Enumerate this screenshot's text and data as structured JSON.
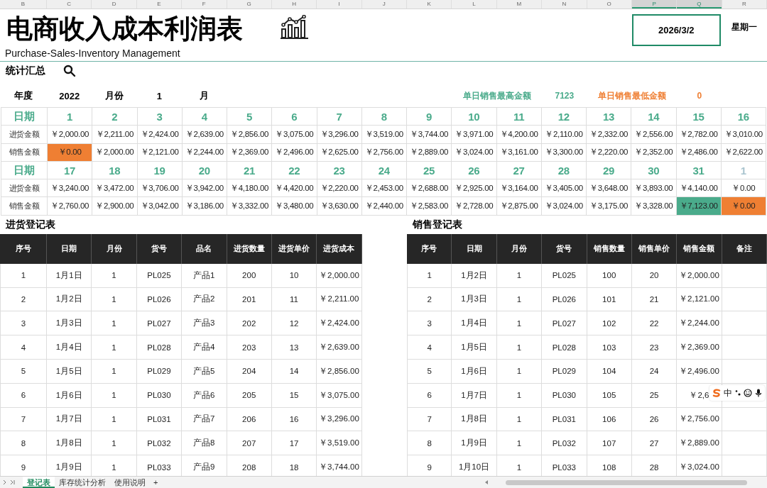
{
  "columns": [
    {
      "label": "B",
      "selected": false
    },
    {
      "label": "C",
      "selected": false
    },
    {
      "label": "D",
      "selected": false
    },
    {
      "label": "E",
      "selected": false
    },
    {
      "label": "F",
      "selected": false
    },
    {
      "label": "G",
      "selected": false
    },
    {
      "label": "H",
      "selected": false
    },
    {
      "label": "I",
      "selected": false
    },
    {
      "label": "J",
      "selected": false
    },
    {
      "label": "K",
      "selected": false
    },
    {
      "label": "L",
      "selected": false
    },
    {
      "label": "M",
      "selected": false
    },
    {
      "label": "N",
      "selected": false
    },
    {
      "label": "O",
      "selected": false
    },
    {
      "label": "P",
      "selected": true
    },
    {
      "label": "Q",
      "selected": true
    },
    {
      "label": "R",
      "selected": false
    }
  ],
  "header": {
    "title": "电商收入成本利润表",
    "subtitle": "Purchase-Sales-Inventory Management",
    "date": "2026/3/2",
    "weekday": "星期一",
    "section": "统计汇总"
  },
  "summary": {
    "year_label": "年度",
    "year": "2022",
    "month_label": "月份",
    "month": "1",
    "month_unit": "月",
    "max_label": "单日销售最高金额",
    "max_value": "7123",
    "min_label": "单日销售最低金额",
    "min_value": "0"
  },
  "calendar": {
    "blocks": [
      {
        "day_label": "日期",
        "purchase_label": "进货金额",
        "sales_label": "销售金额",
        "days": [
          {
            "day": "1",
            "faded": false,
            "purchase": "￥2,000.00",
            "sales": "￥0.00",
            "color": "#ef7f33"
          },
          {
            "day": "2",
            "faded": false,
            "purchase": "￥2,211.00",
            "sales": "￥2,000.00"
          },
          {
            "day": "3",
            "faded": false,
            "purchase": "￥2,424.00",
            "sales": "￥2,121.00"
          },
          {
            "day": "4",
            "faded": false,
            "purchase": "￥2,639.00",
            "sales": "￥2,244.00"
          },
          {
            "day": "5",
            "faded": false,
            "purchase": "￥2,856.00",
            "sales": "￥2,369.00"
          },
          {
            "day": "6",
            "faded": false,
            "purchase": "￥3,075.00",
            "sales": "￥2,496.00"
          },
          {
            "day": "7",
            "faded": false,
            "purchase": "￥3,296.00",
            "sales": "￥2,625.00"
          },
          {
            "day": "8",
            "faded": false,
            "purchase": "￥3,519.00",
            "sales": "￥2,756.00"
          },
          {
            "day": "9",
            "faded": false,
            "purchase": "￥3,744.00",
            "sales": "￥2,889.00"
          },
          {
            "day": "10",
            "faded": false,
            "purchase": "￥3,971.00",
            "sales": "￥3,024.00"
          },
          {
            "day": "11",
            "faded": false,
            "purchase": "￥4,200.00",
            "sales": "￥3,161.00"
          },
          {
            "day": "12",
            "faded": false,
            "purchase": "￥2,110.00",
            "sales": "￥3,300.00"
          },
          {
            "day": "13",
            "faded": false,
            "purchase": "￥2,332.00",
            "sales": "￥2,220.00"
          },
          {
            "day": "14",
            "faded": false,
            "purchase": "￥2,556.00",
            "sales": "￥2,352.00"
          },
          {
            "day": "15",
            "faded": false,
            "purchase": "￥2,782.00",
            "sales": "￥2,486.00"
          },
          {
            "day": "16",
            "faded": false,
            "purchase": "￥3,010.00",
            "sales": "￥2,622.00"
          }
        ]
      },
      {
        "day_label": "日期",
        "purchase_label": "进货金额",
        "sales_label": "销售金额",
        "days": [
          {
            "day": "17",
            "faded": false,
            "purchase": "￥3,240.00",
            "sales": "￥2,760.00"
          },
          {
            "day": "18",
            "faded": false,
            "purchase": "￥3,472.00",
            "sales": "￥2,900.00"
          },
          {
            "day": "19",
            "faded": false,
            "purchase": "￥3,706.00",
            "sales": "￥3,042.00"
          },
          {
            "day": "20",
            "faded": false,
            "purchase": "￥3,942.00",
            "sales": "￥3,186.00"
          },
          {
            "day": "21",
            "faded": false,
            "purchase": "￥4,180.00",
            "sales": "￥3,332.00"
          },
          {
            "day": "22",
            "faded": false,
            "purchase": "￥4,420.00",
            "sales": "￥3,480.00"
          },
          {
            "day": "23",
            "faded": false,
            "purchase": "￥2,220.00",
            "sales": "￥3,630.00"
          },
          {
            "day": "24",
            "faded": false,
            "purchase": "￥2,453.00",
            "sales": "￥2,440.00"
          },
          {
            "day": "25",
            "faded": false,
            "purchase": "￥2,688.00",
            "sales": "￥2,583.00"
          },
          {
            "day": "26",
            "faded": false,
            "purchase": "￥2,925.00",
            "sales": "￥2,728.00"
          },
          {
            "day": "27",
            "faded": false,
            "purchase": "￥3,164.00",
            "sales": "￥2,875.00"
          },
          {
            "day": "28",
            "faded": false,
            "purchase": "￥3,405.00",
            "sales": "￥3,024.00"
          },
          {
            "day": "29",
            "faded": false,
            "purchase": "￥3,648.00",
            "sales": "￥3,175.00"
          },
          {
            "day": "30",
            "faded": false,
            "purchase": "￥3,893.00",
            "sales": "￥3,328.00"
          },
          {
            "day": "31",
            "faded": false,
            "purchase": "￥4,140.00",
            "sales": "￥7,123.00",
            "color": "#4aab8b"
          },
          {
            "day": "1",
            "faded": true,
            "purchase": "￥0.00",
            "sales": "￥0.00",
            "color": "#ef7f33"
          }
        ]
      }
    ]
  },
  "purchase_register": {
    "title": "进货登记表",
    "columns": [
      "序号",
      "日期",
      "月份",
      "货号",
      "品名",
      "进货数量",
      "进货单价",
      "进货成本"
    ],
    "rows": [
      [
        "1",
        "1月1日",
        "1",
        "PL025",
        "产品1",
        "200",
        "10",
        "￥2,000.00"
      ],
      [
        "2",
        "1月2日",
        "1",
        "PL026",
        "产品2",
        "201",
        "11",
        "￥2,211.00"
      ],
      [
        "3",
        "1月3日",
        "1",
        "PL027",
        "产品3",
        "202",
        "12",
        "￥2,424.00"
      ],
      [
        "4",
        "1月4日",
        "1",
        "PL028",
        "产品4",
        "203",
        "13",
        "￥2,639.00"
      ],
      [
        "5",
        "1月5日",
        "1",
        "PL029",
        "产品5",
        "204",
        "14",
        "￥2,856.00"
      ],
      [
        "6",
        "1月6日",
        "1",
        "PL030",
        "产品6",
        "205",
        "15",
        "￥3,075.00"
      ],
      [
        "7",
        "1月7日",
        "1",
        "PL031",
        "产品7",
        "206",
        "16",
        "￥3,296.00"
      ],
      [
        "8",
        "1月8日",
        "1",
        "PL032",
        "产品8",
        "207",
        "17",
        "￥3,519.00"
      ],
      [
        "9",
        "1月9日",
        "1",
        "PL033",
        "产品9",
        "208",
        "18",
        "￥3,744.00"
      ]
    ]
  },
  "sales_register": {
    "title": "销售登记表",
    "columns": [
      "序号",
      "日期",
      "月份",
      "货号",
      "销售数量",
      "销售单价",
      "销售金额",
      "备注"
    ],
    "rows": [
      [
        "1",
        "1月2日",
        "1",
        "PL025",
        "100",
        "20",
        "￥2,000.00"
      ],
      [
        "2",
        "1月3日",
        "1",
        "PL026",
        "101",
        "21",
        "￥2,121.00"
      ],
      [
        "3",
        "1月4日",
        "1",
        "PL027",
        "102",
        "22",
        "￥2,244.00"
      ],
      [
        "4",
        "1月5日",
        "1",
        "PL028",
        "103",
        "23",
        "￥2,369.00"
      ],
      [
        "5",
        "1月6日",
        "1",
        "PL029",
        "104",
        "24",
        "￥2,496.00"
      ],
      [
        "6",
        "1月7日",
        "1",
        "PL030",
        "105",
        "25",
        "￥2,6"
      ],
      [
        "7",
        "1月8日",
        "1",
        "PL031",
        "106",
        "26",
        "￥2,756.00"
      ],
      [
        "8",
        "1月9日",
        "1",
        "PL032",
        "107",
        "27",
        "￥2,889.00"
      ],
      [
        "9",
        "1月10日",
        "1",
        "PL033",
        "108",
        "28",
        "￥3,024.00"
      ]
    ]
  },
  "ime_toolbar": {
    "items": [
      {
        "kind": "logo"
      },
      {
        "kind": "text",
        "label": "中"
      },
      {
        "kind": "punct"
      },
      {
        "kind": "emoji"
      },
      {
        "kind": "mic"
      }
    ]
  },
  "sheet_tabs": {
    "tabs": [
      {
        "label": "登记表",
        "selected": true
      },
      {
        "label": "库存统计分析",
        "selected": false
      },
      {
        "label": "使用说明",
        "selected": false
      }
    ],
    "add": "+"
  }
}
